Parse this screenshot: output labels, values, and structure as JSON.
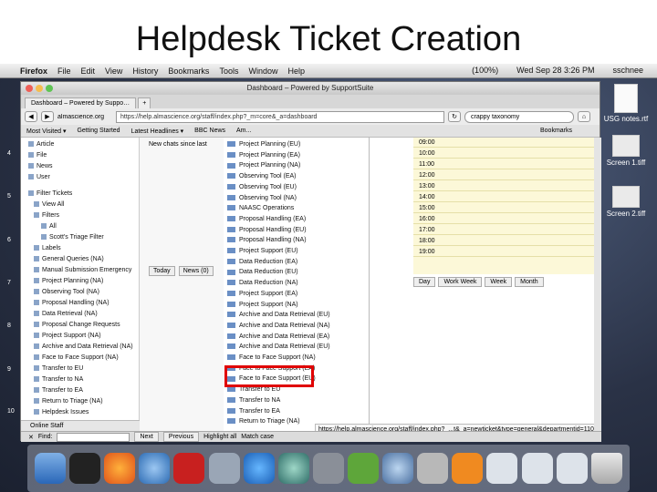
{
  "slide": {
    "title": "Helpdesk Ticket Creation"
  },
  "menubar": {
    "items": [
      "Firefox",
      "File",
      "Edit",
      "View",
      "History",
      "Bookmarks",
      "Tools",
      "Window",
      "Help"
    ],
    "status": "(100%)",
    "datetime": "Wed Sep 28 3:26 PM",
    "user": "sschnee"
  },
  "window": {
    "title": "Dashboard – Powered by SupportSuite",
    "tabs": [
      "Dashboard – Powered by Suppo…"
    ],
    "url": "https://help.almascience.org/staff/index.php?_m=core&_a=dashboard",
    "site": "almascience.org",
    "search_placeholder": "crappy taxonomy",
    "bookmarks": [
      "Most Visited ▾",
      "Getting Started",
      "Latest Headlines ▾",
      "BBC News",
      "Am..."
    ],
    "bookmarks_right": "Bookmarks"
  },
  "sidebar": {
    "items": [
      "Article",
      "File",
      "News",
      "User",
      "Filter Tickets",
      "View All",
      "Filters",
      "All",
      "Scott's Triage Filter",
      "Labels",
      "General Queries (NA)",
      "Manual Submission Emergency",
      "Project Planning (NA)",
      "Observing Tool (NA)",
      "Proposal Handling (NA)",
      "Data Retrieval (NA)",
      "Proposal Change Requests",
      "Project Support (NA)",
      "Archive and Data Retrieval (NA)",
      "Face to Face Support (NA)",
      "Transfer to EU",
      "Transfer to NA",
      "Transfer to EA",
      "Return to Triage (NA)",
      "Helpdesk Issues"
    ],
    "footer": "Online Staff"
  },
  "midpanel": {
    "message": "New chats since last",
    "tabs": [
      "Today",
      "News (0)"
    ]
  },
  "dropdown": {
    "items": [
      "Project Planning (EU)",
      "Project Planning (EA)",
      "Project Planning (NA)",
      "Observing Tool (EA)",
      "Observing Tool (EU)",
      "Observing Tool (NA)",
      "NAASC Operations",
      "Proposal Handling (EA)",
      "Proposal Handling (EU)",
      "Proposal Handling (NA)",
      "Project Support (EU)",
      "Data Reduction (EA)",
      "Data Reduction (EU)",
      "Data Reduction (NA)",
      "Project Support (EA)",
      "Project Support (NA)",
      "Archive and Data Retrieval (EU)",
      "Archive and Data Retrieval (NA)",
      "Archive and Data Retrieval (EA)",
      "Archive and Data Retrieval (EU)",
      "Face to Face Support (NA)",
      "Face to Face Support (EA)",
      "Face to Face Support (EU)",
      "Transfer to EU",
      "Transfer to NA",
      "Transfer to EA",
      "Return to Triage (NA)"
    ],
    "highlighted": "Project Support (NA)"
  },
  "calendar": {
    "times": [
      "09:00",
      "10:00",
      "11:00",
      "12:00",
      "13:00",
      "14:00",
      "15:00",
      "16:00",
      "17:00",
      "18:00",
      "19:00"
    ],
    "views": [
      "Day",
      "Work Week",
      "Week",
      "Month"
    ]
  },
  "statusbar": {
    "find_label": "Find:",
    "next": "Next",
    "previous": "Previous",
    "highlight_all": "Highlight all",
    "match_case": "Match case",
    "link_url": "https://help.almascience.org/staff/index.php?_...t&_a=newticket&type=general&departmentid=110"
  },
  "desktop": {
    "files": [
      "USG notes.rtf",
      "Screen 1.tiff",
      "Screen 2.tiff"
    ]
  },
  "line_numbers": [
    "4",
    "5",
    "6",
    "7",
    "8",
    "9",
    "10"
  ],
  "colors": {
    "highlight_border": "#e00000",
    "calendar_bg": "#fcf8d8",
    "desktop_bg": "#2a3246"
  }
}
